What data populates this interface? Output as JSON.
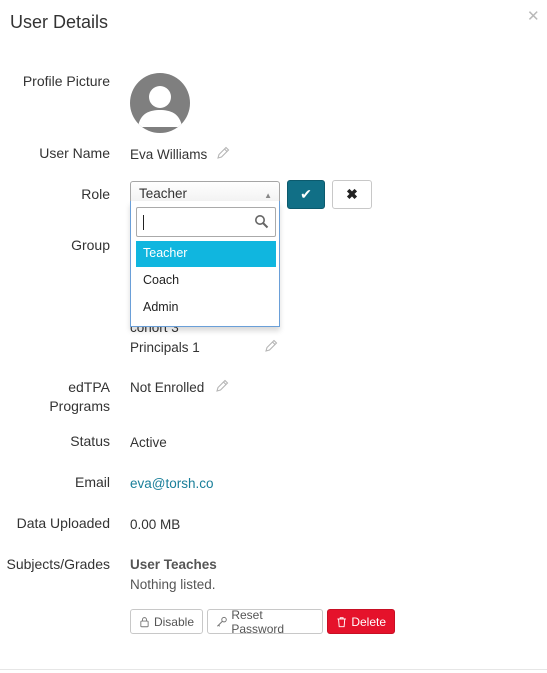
{
  "modal": {
    "title": "User Details",
    "close_icon": "close-icon"
  },
  "labels": {
    "profile_picture": "Profile Picture",
    "user_name": "User Name",
    "role": "Role",
    "group": "Group",
    "edtpa_line1": "edTPA",
    "edtpa_line2": "Programs",
    "status": "Status",
    "email": "Email",
    "data_uploaded": "Data Uploaded",
    "subjects_grades": "Subjects/Grades"
  },
  "values": {
    "user_name": "Eva Williams",
    "role_selected": "Teacher",
    "groups": [
      "cohort 3",
      "Principals 1"
    ],
    "edtpa": "Not Enrolled",
    "status": "Active",
    "email": "eva@torsh.co",
    "data_uploaded": "0.00 MB",
    "subjects_heading": "User Teaches",
    "subjects_value": "Nothing listed."
  },
  "role_dropdown": {
    "search_value": "",
    "options": [
      "Teacher",
      "Coach",
      "Admin"
    ],
    "active_index": 0
  },
  "buttons": {
    "disable": "Disable",
    "reset_password": "Reset Password",
    "delete": "Delete"
  },
  "colors": {
    "accent_teal": "#116f86",
    "dropdown_highlight": "#10b6df",
    "link": "#1a7f9a",
    "danger": "#e5122b"
  }
}
